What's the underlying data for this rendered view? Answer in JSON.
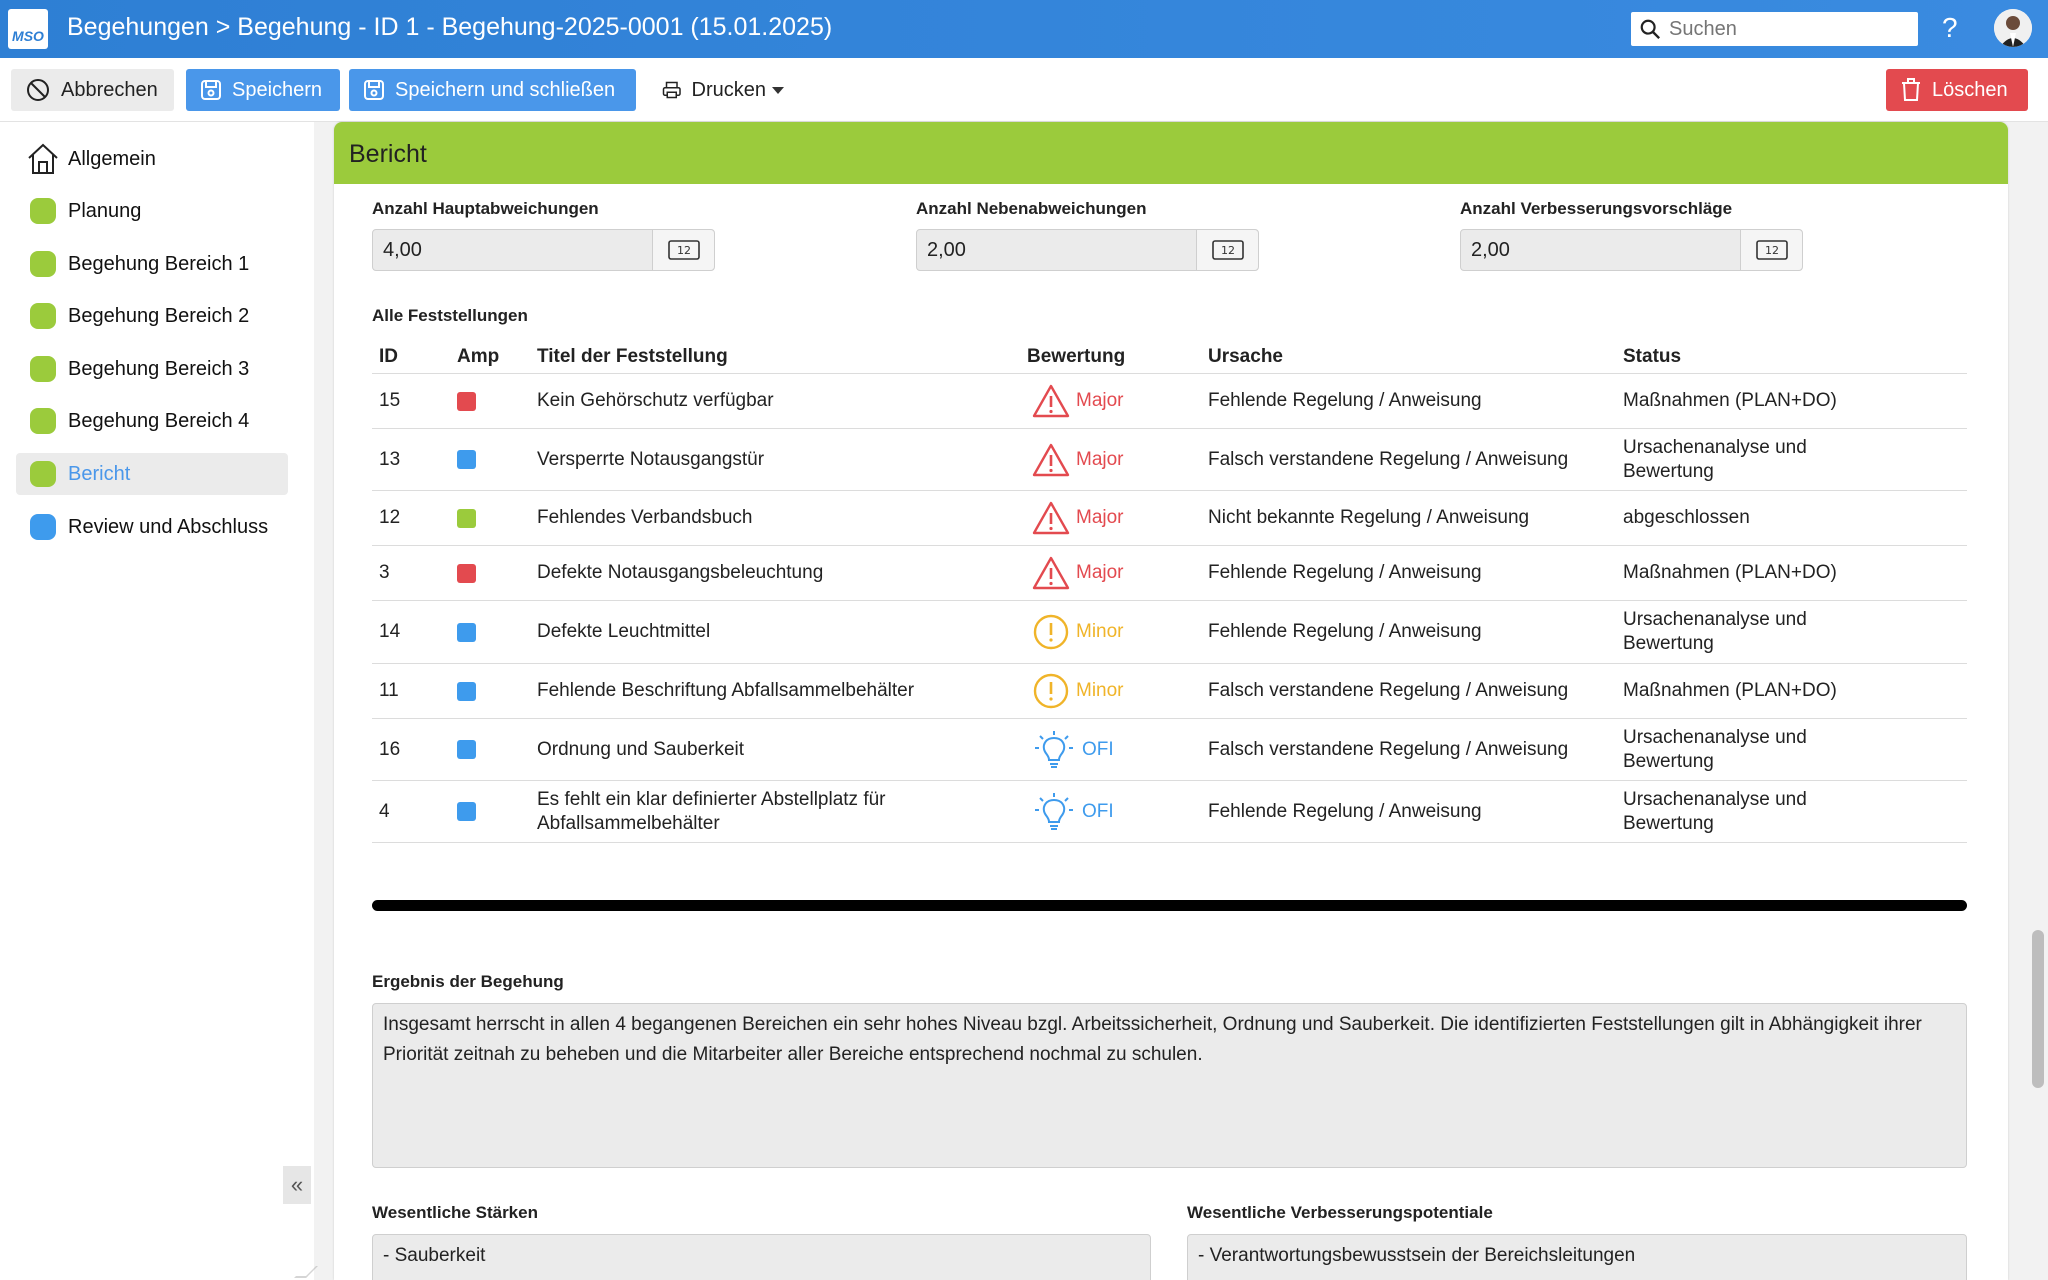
{
  "header": {
    "logo_text": "MSO",
    "title": "Begehungen > Begehung - ID 1 - Begehung-2025-0001 (15.01.2025)",
    "search_placeholder": "Suchen",
    "help_label": "?"
  },
  "toolbar": {
    "cancel_label": "Abbrechen",
    "save_label": "Speichern",
    "save_close_label": "Speichern und schließen",
    "print_label": "Drucken",
    "delete_label": "Löschen"
  },
  "sidebar": {
    "items": [
      {
        "label": "Allgemein",
        "color": ""
      },
      {
        "label": "Planung",
        "color": "#9bcb3c"
      },
      {
        "label": "Begehung Bereich 1",
        "color": "#9bcb3c"
      },
      {
        "label": "Begehung Bereich 2",
        "color": "#9bcb3c"
      },
      {
        "label": "Begehung Bereich 3",
        "color": "#9bcb3c"
      },
      {
        "label": "Begehung Bereich 4",
        "color": "#9bcb3c"
      },
      {
        "label": "Bericht",
        "color": "#9bcb3c"
      },
      {
        "label": "Review und Abschluss",
        "color": "#3e9bed"
      }
    ],
    "collapse_label": "«"
  },
  "panel": {
    "title": "Bericht",
    "fields": [
      {
        "label": "Anzahl Hauptabweichungen",
        "value": "4,00",
        "icon_text": "12"
      },
      {
        "label": "Anzahl Nebenabweichungen",
        "value": "2,00",
        "icon_text": "12"
      },
      {
        "label": "Anzahl Verbesserungsvorschläge",
        "value": "2,00",
        "icon_text": "12"
      }
    ],
    "table_label": "Alle Feststellungen",
    "table": {
      "headers": [
        "ID",
        "Amp",
        "Titel der Feststellung",
        "Bewertung",
        "Ursache",
        "Status"
      ],
      "rows": [
        {
          "id": "15",
          "amp": "#e34a4f",
          "title": "Kein Gehörschutz verfügbar",
          "rating": "Major",
          "rating_type": "major",
          "cause": "Fehlende Regelung / Anweisung",
          "status": "Maßnahmen (PLAN+DO)"
        },
        {
          "id": "13",
          "amp": "#3e9bed",
          "title": "Versperrte Notausgangstür",
          "rating": "Major",
          "rating_type": "major",
          "cause": "Falsch verstandene Regelung / Anweisung",
          "status": "Ursachenanalyse und Bewertung"
        },
        {
          "id": "12",
          "amp": "#9bcb3c",
          "title": "Fehlendes Verbandsbuch",
          "rating": "Major",
          "rating_type": "major",
          "cause": "Nicht bekannte Regelung / Anweisung",
          "status": "abgeschlossen"
        },
        {
          "id": "3",
          "amp": "#e34a4f",
          "title": "Defekte Notausgangsbeleuchtung",
          "rating": "Major",
          "rating_type": "major",
          "cause": "Fehlende Regelung / Anweisung",
          "status": "Maßnahmen (PLAN+DO)"
        },
        {
          "id": "14",
          "amp": "#3e9bed",
          "title": "Defekte Leuchtmittel",
          "rating": "Minor",
          "rating_type": "minor",
          "cause": "Fehlende Regelung / Anweisung",
          "status": "Ursachenanalyse und Bewertung"
        },
        {
          "id": "11",
          "amp": "#3e9bed",
          "title": "Fehlende Beschriftung Abfallsammelbehälter",
          "rating": "Minor",
          "rating_type": "minor",
          "cause": "Falsch verstandene Regelung / Anweisung",
          "status": "Maßnahmen (PLAN+DO)"
        },
        {
          "id": "16",
          "amp": "#3e9bed",
          "title": "Ordnung und Sauberkeit",
          "rating": "OFI",
          "rating_type": "ofi",
          "cause": "Falsch verstandene Regelung / Anweisung",
          "status": "Ursachenanalyse und Bewertung"
        },
        {
          "id": "4",
          "amp": "#3e9bed",
          "title": "Es fehlt ein klar definierter Abstellplatz für Abfallsammelbehälter",
          "rating": "OFI",
          "rating_type": "ofi",
          "cause": "Fehlende Regelung / Anweisung",
          "status": "Ursachenanalyse und Bewertung"
        }
      ]
    },
    "result_label": "Ergebnis der Begehung",
    "result_text": "Insgesamt herrscht in allen 4 begangenen Bereichen ein sehr hohes Niveau bzgl. Arbeitssicherheit, Ordnung und Sauberkeit. Die identifizierten Feststellungen gilt in Abhängigkeit ihrer Priorität zeitnah zu beheben und die Mitarbeiter aller Bereiche entsprechend nochmal zu schulen.",
    "strengths_label": "Wesentliche Stärken",
    "strengths_text": "- Sauberkeit",
    "improvements_label": "Wesentliche Verbesserungspotentiale",
    "improvements_text": "- Verantwortungsbewusstsein der Bereichsleitungen"
  },
  "colors": {
    "major": "#e34a4f",
    "minor": "#f0b429",
    "ofi": "#3e9bed",
    "accent": "#4a97ea",
    "section_green": "#9bcb3c"
  }
}
